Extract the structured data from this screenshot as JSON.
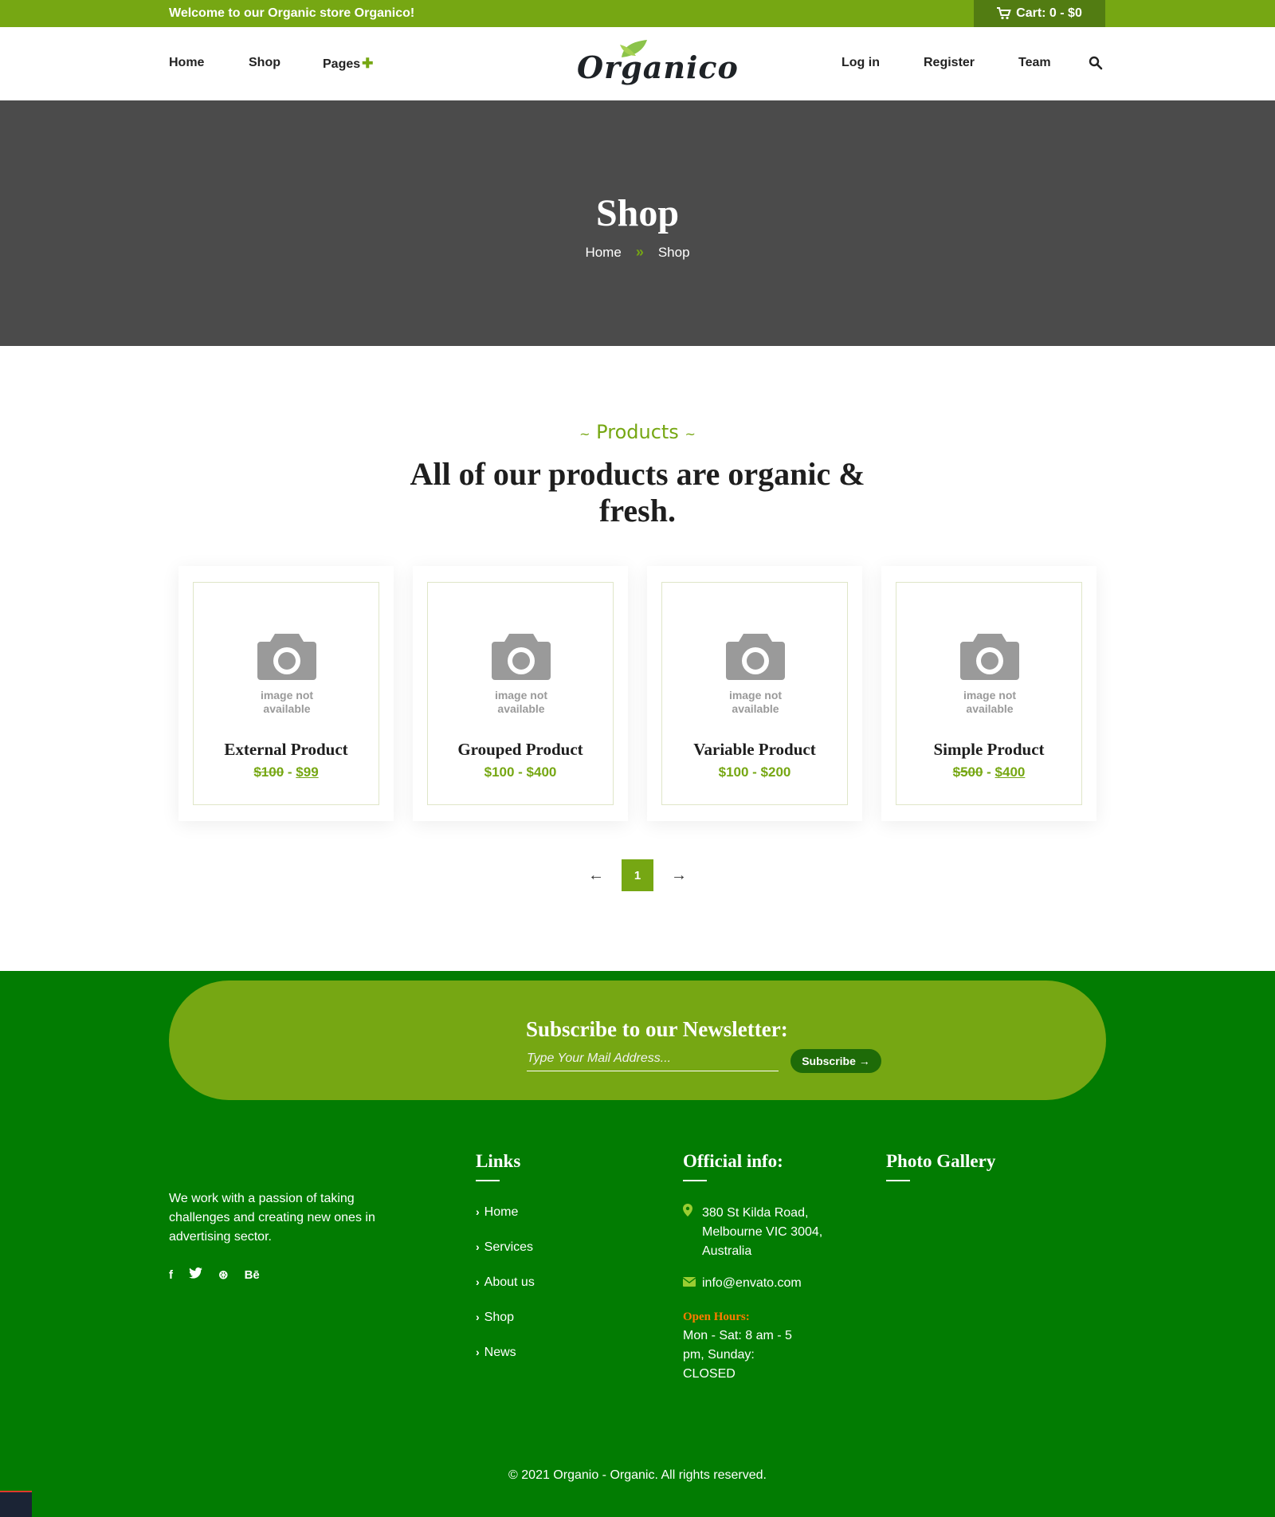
{
  "topbar": {
    "welcome": "Welcome to our Organic store Organico!",
    "cart": "Cart: 0 - $0"
  },
  "nav": {
    "left": [
      "Home",
      "Shop",
      "Pages"
    ],
    "right": [
      "Log in",
      "Register",
      "Team"
    ],
    "logo": "Organico"
  },
  "banner": {
    "title": "Shop",
    "crumb_home": "Home",
    "crumb_current": "Shop",
    "crumb_sep": "»"
  },
  "section": {
    "subtitle": "Products",
    "title": "All of our products are organic & fresh."
  },
  "products": [
    {
      "name": "External Product",
      "old_price": "$100",
      "price": "$99",
      "na": "image not available"
    },
    {
      "name": "Grouped Product",
      "price_range": "$100 - $400",
      "na": "image not available"
    },
    {
      "name": "Variable Product",
      "price_range": "$100 - $200",
      "na": "image not available"
    },
    {
      "name": "Simple Product",
      "old_price": "$500",
      "price": "$400",
      "na": "image not available"
    }
  ],
  "pager": {
    "prev": "←",
    "current": "1",
    "next": "→"
  },
  "newsletter": {
    "title": "Subscribe to our Newsletter:",
    "placeholder": "Type Your Mail Address...",
    "button": "Subscribe →"
  },
  "footer": {
    "about": "We work with a passion of taking challenges and creating new ones in advertising sector.",
    "socials": [
      "f",
      "🐦",
      "⊛",
      "Bē"
    ],
    "links_title": "Links",
    "links": [
      "Home",
      "Services",
      "About us",
      "Shop",
      "News"
    ],
    "info_title": "Official info:",
    "address": "380 St Kilda Road, Melbourne VIC 3004, Australia",
    "email": "info@envato.com",
    "hours_title": "Open Hours:",
    "hours": "Mon - Sat: 8 am - 5 pm, Sunday: CLOSED",
    "gallery_title": "Photo Gallery",
    "copyright": "© 2021 Organio - Organic. All rights reserved."
  },
  "colors": {
    "brand_green": "#76a713",
    "dark_green": "#527c12",
    "footer_green": "#027c02",
    "banner_gray": "#4b4b4b",
    "hours_orange": "#ff7b00"
  }
}
